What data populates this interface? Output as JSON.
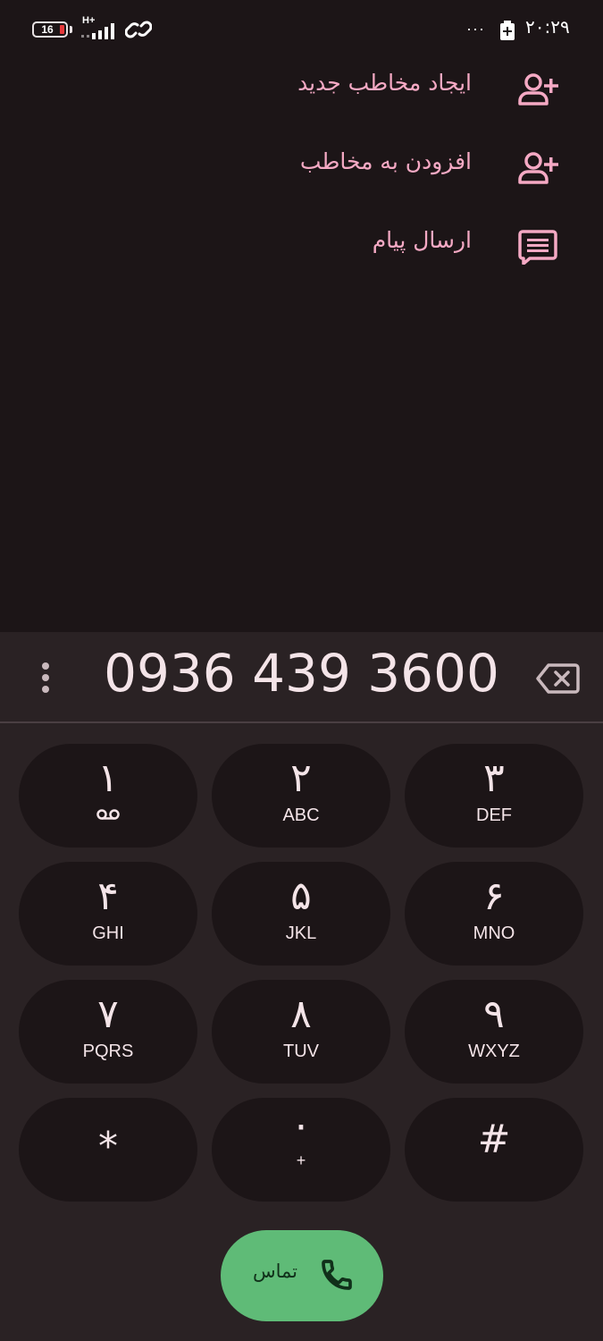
{
  "status_bar": {
    "battery_level": "16",
    "network_type": "H+",
    "overflow_dots": "···",
    "time": "۲۰:۲۹"
  },
  "suggestions": [
    {
      "label": "ایجاد مخاطب جدید",
      "icon": "person-add-icon"
    },
    {
      "label": "افزودن به مخاطب",
      "icon": "person-add-icon"
    },
    {
      "label": "ارسال پیام",
      "icon": "message-icon"
    }
  ],
  "dialer": {
    "number": "0936 439 3600"
  },
  "keypad": {
    "keys": [
      {
        "digit": "۱",
        "letters": ""
      },
      {
        "digit": "۲",
        "letters": "ABC"
      },
      {
        "digit": "۳",
        "letters": "DEF"
      },
      {
        "digit": "۴",
        "letters": "GHI"
      },
      {
        "digit": "۵",
        "letters": "JKL"
      },
      {
        "digit": "۶",
        "letters": "MNO"
      },
      {
        "digit": "۷",
        "letters": "PQRS"
      },
      {
        "digit": "۸",
        "letters": "TUV"
      },
      {
        "digit": "۹",
        "letters": "WXYZ"
      },
      {
        "digit": "*",
        "letters": ""
      },
      {
        "digit": "۰",
        "letters": "+"
      },
      {
        "digit": "#",
        "letters": ""
      }
    ]
  },
  "call_button": {
    "label": "تماس"
  },
  "colors": {
    "background": "#1c1517",
    "keypad_background": "#2a2224",
    "accent_pink": "#f5a9c4",
    "call_green": "#5fbb77",
    "battery_low": "#e5393b"
  }
}
